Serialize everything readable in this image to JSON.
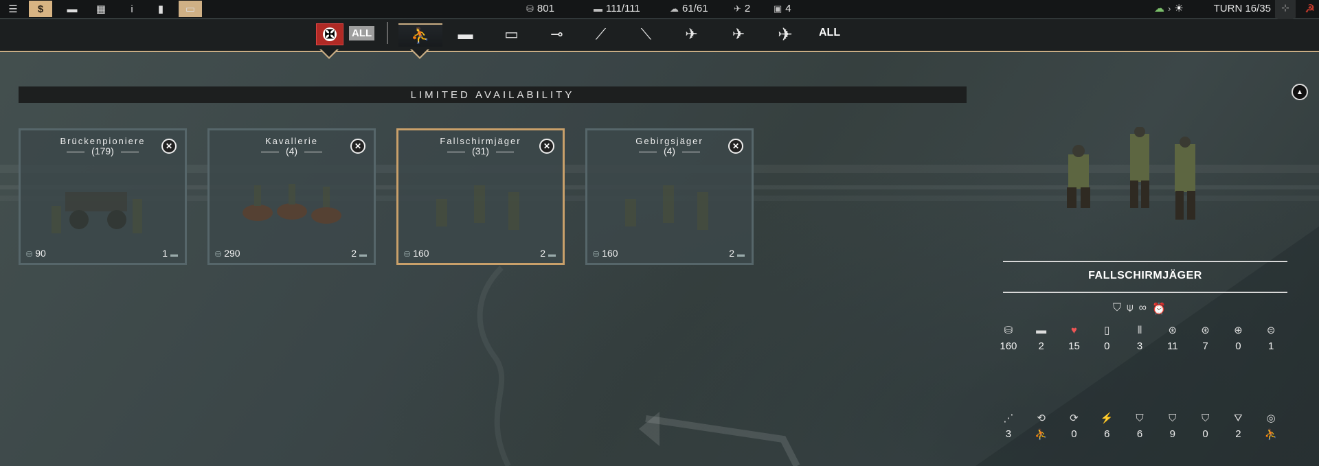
{
  "topbar": {
    "buttons": [
      {
        "name": "menu-button",
        "icon": "menu-icon",
        "glyph": "☰"
      },
      {
        "name": "purchase-button",
        "icon": "dollar-icon",
        "glyph": "$"
      },
      {
        "name": "chat-button",
        "icon": "chat-icon",
        "glyph": "▬"
      },
      {
        "name": "overview-button",
        "icon": "grid-icon",
        "glyph": "▦"
      },
      {
        "name": "info-button",
        "icon": "info-icon",
        "glyph": "i"
      },
      {
        "name": "stats-button",
        "icon": "bar-chart-icon",
        "glyph": "▮"
      },
      {
        "name": "minimap-button",
        "icon": "minimap-icon",
        "glyph": "▭"
      }
    ],
    "resources": {
      "prestige": "801",
      "core_slots": "111/111",
      "aux_slots": "61/61",
      "air_slots": "2",
      "other_slots": "4"
    },
    "turn": "TURN 16/35"
  },
  "filter": {
    "all_nations": "ALL",
    "all_classes": "ALL",
    "categories": [
      {
        "name": "infantry",
        "icon": "infantry-icon",
        "glyph": "⛹"
      },
      {
        "name": "tank",
        "icon": "tank-icon",
        "glyph": "▬"
      },
      {
        "name": "recon",
        "icon": "recon-vehicle-icon",
        "glyph": "▭"
      },
      {
        "name": "anti-tank",
        "icon": "anti-tank-gun-icon",
        "glyph": "⊸"
      },
      {
        "name": "artillery",
        "icon": "artillery-icon",
        "glyph": "⟋"
      },
      {
        "name": "anti-air",
        "icon": "anti-air-icon",
        "glyph": "⟍"
      },
      {
        "name": "fighter",
        "icon": "fighter-plane-icon",
        "glyph": "✈"
      },
      {
        "name": "tactical-bomber",
        "icon": "tactical-bomber-icon",
        "glyph": "✈"
      },
      {
        "name": "strategic-bomber",
        "icon": "strategic-bomber-icon",
        "glyph": "✈"
      }
    ]
  },
  "banner": "LIMITED AVAILABILITY",
  "units": [
    {
      "name": "Brückenpioniere",
      "count": "(179)",
      "cost": "90",
      "slots": "1"
    },
    {
      "name": "Kavallerie",
      "count": "(4)",
      "cost": "290",
      "slots": "2"
    },
    {
      "name": "Fallschirmjäger",
      "count": "(31)",
      "cost": "160",
      "slots": "2"
    },
    {
      "name": "Gebirgsjäger",
      "count": "(4)",
      "cost": "160",
      "slots": "2"
    }
  ],
  "detail": {
    "title": "FALLSCHIRMJÄGER",
    "stats_row1": [
      {
        "icon": "cost-icon",
        "glyph": "⛁",
        "value": "160"
      },
      {
        "icon": "slot-icon",
        "glyph": "▬",
        "value": "2"
      },
      {
        "icon": "health-icon",
        "glyph": "♥",
        "value": "15"
      },
      {
        "icon": "fuel-icon",
        "glyph": "▯",
        "value": "0"
      },
      {
        "icon": "ammo-icon",
        "glyph": "⦀",
        "value": "3"
      },
      {
        "icon": "soft-attack-icon",
        "glyph": "⊛",
        "value": "11"
      },
      {
        "icon": "hard-attack-icon",
        "glyph": "⊛",
        "value": "7"
      },
      {
        "icon": "air-attack-icon",
        "glyph": "⊕",
        "value": "0"
      },
      {
        "icon": "naval-attack-icon",
        "glyph": "⊜",
        "value": "1"
      }
    ],
    "stats_row2": [
      {
        "icon": "movement-icon",
        "glyph": "⋰",
        "value": "3"
      },
      {
        "icon": "movement-type-icon",
        "glyph": "⟲",
        "value": "⛹"
      },
      {
        "icon": "initiative-icon",
        "glyph": "⟳",
        "value": "0"
      },
      {
        "icon": "spotting-icon",
        "glyph": "⚡",
        "value": "6"
      },
      {
        "icon": "ground-defense-icon",
        "glyph": "⛉",
        "value": "6"
      },
      {
        "icon": "air-defense-icon",
        "glyph": "⛉",
        "value": "9"
      },
      {
        "icon": "close-defense-icon",
        "glyph": "⛉",
        "value": "0"
      },
      {
        "icon": "range-icon",
        "glyph": "⛛",
        "value": "2"
      },
      {
        "icon": "target-type-icon",
        "glyph": "◎",
        "value": "⛹"
      }
    ]
  },
  "colors": {
    "accent": "#c9ad84",
    "germany_flag": "#b02a25"
  }
}
